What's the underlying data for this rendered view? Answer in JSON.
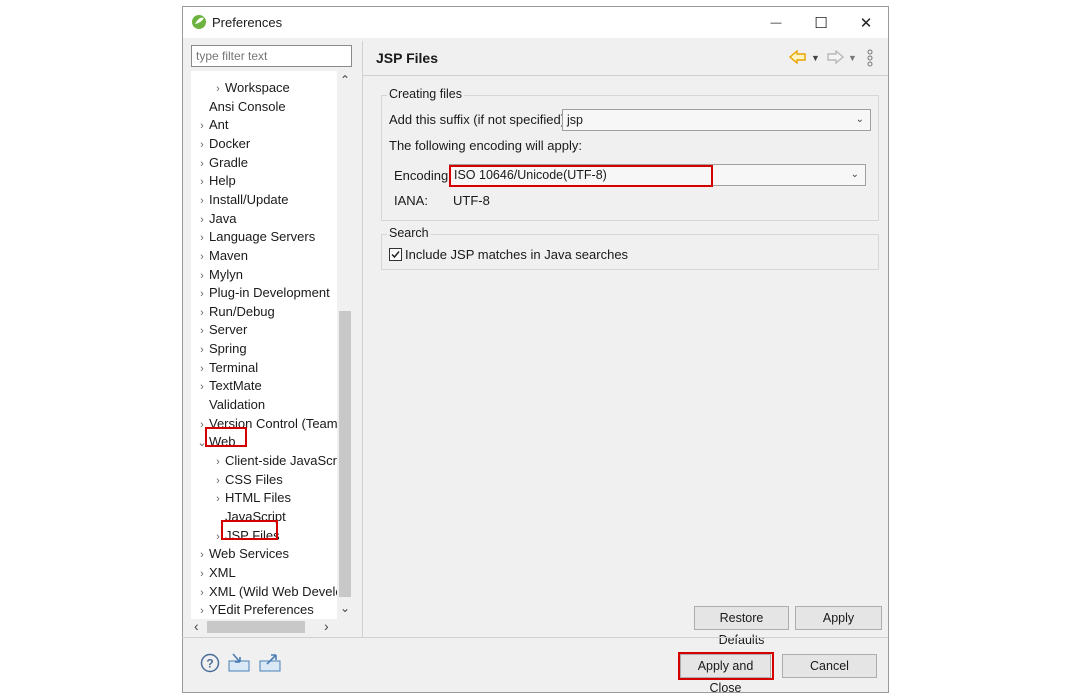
{
  "window": {
    "title": "Preferences",
    "controls": {
      "minimize": "—",
      "maximize": "☐",
      "close": "✕"
    }
  },
  "filter": {
    "placeholder": "type filter text"
  },
  "tree": {
    "items": [
      {
        "label": "Workspace",
        "chevron": "›",
        "level": 1
      },
      {
        "label": "Ansi Console",
        "chevron": "",
        "level": 0
      },
      {
        "label": "Ant",
        "chevron": "›",
        "level": 0
      },
      {
        "label": "Docker",
        "chevron": "›",
        "level": 0
      },
      {
        "label": "Gradle",
        "chevron": "›",
        "level": 0
      },
      {
        "label": "Help",
        "chevron": "›",
        "level": 0
      },
      {
        "label": "Install/Update",
        "chevron": "›",
        "level": 0
      },
      {
        "label": "Java",
        "chevron": "›",
        "level": 0
      },
      {
        "label": "Language Servers",
        "chevron": "›",
        "level": 0
      },
      {
        "label": "Maven",
        "chevron": "›",
        "level": 0
      },
      {
        "label": "Mylyn",
        "chevron": "›",
        "level": 0
      },
      {
        "label": "Plug-in Development",
        "chevron": "›",
        "level": 0
      },
      {
        "label": "Run/Debug",
        "chevron": "›",
        "level": 0
      },
      {
        "label": "Server",
        "chevron": "›",
        "level": 0
      },
      {
        "label": "Spring",
        "chevron": "›",
        "level": 0
      },
      {
        "label": "Terminal",
        "chevron": "›",
        "level": 0
      },
      {
        "label": "TextMate",
        "chevron": "›",
        "level": 0
      },
      {
        "label": "Validation",
        "chevron": "",
        "level": 0
      },
      {
        "label": "Version Control (Team)",
        "chevron": "›",
        "level": 0
      },
      {
        "label": "Web",
        "chevron": "⌄",
        "level": 0
      },
      {
        "label": "Client-side JavaScript",
        "chevron": "›",
        "level": 1
      },
      {
        "label": "CSS Files",
        "chevron": "›",
        "level": 1
      },
      {
        "label": "HTML Files",
        "chevron": "›",
        "level": 1
      },
      {
        "label": "JavaScript",
        "chevron": "",
        "level": 1
      },
      {
        "label": "JSP Files",
        "chevron": "›",
        "level": 1
      },
      {
        "label": "Web Services",
        "chevron": "›",
        "level": 0
      },
      {
        "label": "XML",
        "chevron": "›",
        "level": 0
      },
      {
        "label": "XML (Wild Web Developer)",
        "chevron": "›",
        "level": 0
      },
      {
        "label": "YEdit Preferences",
        "chevron": "›",
        "level": 0
      }
    ],
    "scroll_up": "⌃",
    "scroll_down": "⌄",
    "scroll_left": "‹",
    "scroll_right": "›"
  },
  "page": {
    "title": "JSP Files",
    "creating_group": "Creating files",
    "suffix_label": "Add this suffix (if not specified):",
    "suffix_value": "jsp",
    "encoding_note": "The following encoding will apply:",
    "encoding_label": "Encoding:",
    "encoding_value": "ISO 10646/Unicode(UTF-8)",
    "iana_label": "IANA:",
    "iana_value": "UTF-8",
    "search_group": "Search",
    "include_checkbox_label": "Include JSP matches in Java searches",
    "include_checked": true
  },
  "buttons": {
    "restore_defaults": "Restore Defaults",
    "apply": "Apply",
    "apply_and_close": "Apply and Close",
    "cancel": "Cancel"
  },
  "icons": {
    "back": "back-arrow-icon",
    "forward": "forward-arrow-icon",
    "menu": "view-menu-icon",
    "help": "help-icon",
    "import": "import-icon",
    "export": "export-icon"
  },
  "colors": {
    "highlight": "#d40000",
    "back_arrow": "#e8a400"
  }
}
